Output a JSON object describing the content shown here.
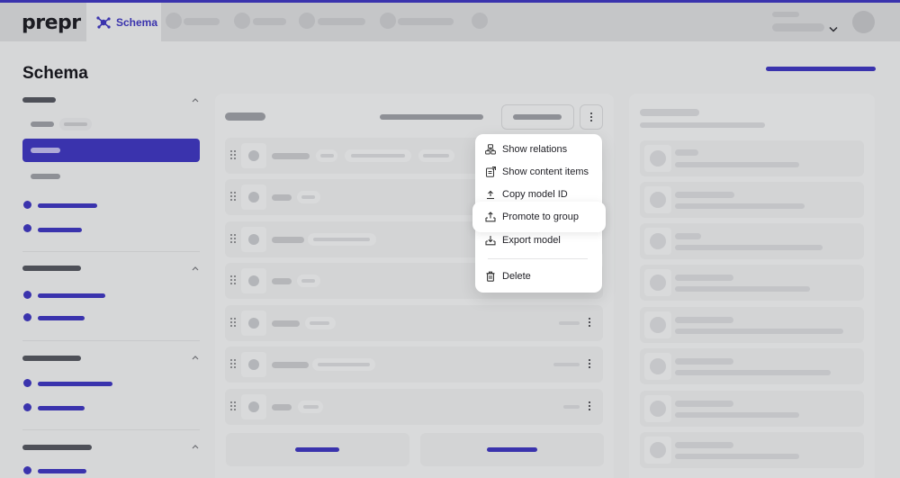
{
  "brand": {
    "logo": "prepr",
    "accent": "#3a33ad"
  },
  "topbar": {
    "active_tab": {
      "label": "Schema",
      "icon": "schema-icon"
    },
    "placeholder_tabs": 5,
    "user_menu": {
      "icon": "chevron-down-icon"
    }
  },
  "page": {
    "title": "Schema"
  },
  "sidebar": {
    "groups": [
      {
        "icon": "chevron-up-icon",
        "expanded": true
      },
      {
        "icon": "chevron-up-icon",
        "expanded": true
      },
      {
        "icon": "chevron-up-icon",
        "expanded": true
      },
      {
        "icon": "chevron-up-icon",
        "expanded": true
      }
    ]
  },
  "context_menu": {
    "items": [
      {
        "label": "Show relations",
        "icon": "relations-icon"
      },
      {
        "label": "Show content items",
        "icon": "content-items-icon"
      },
      {
        "label": "Copy model ID",
        "icon": "copy-id-icon"
      },
      {
        "label": "Promote to group",
        "icon": "promote-icon",
        "highlighted": true
      },
      {
        "label": "Export model",
        "icon": "export-icon"
      },
      {
        "label": "Delete",
        "icon": "trash-icon"
      }
    ]
  }
}
